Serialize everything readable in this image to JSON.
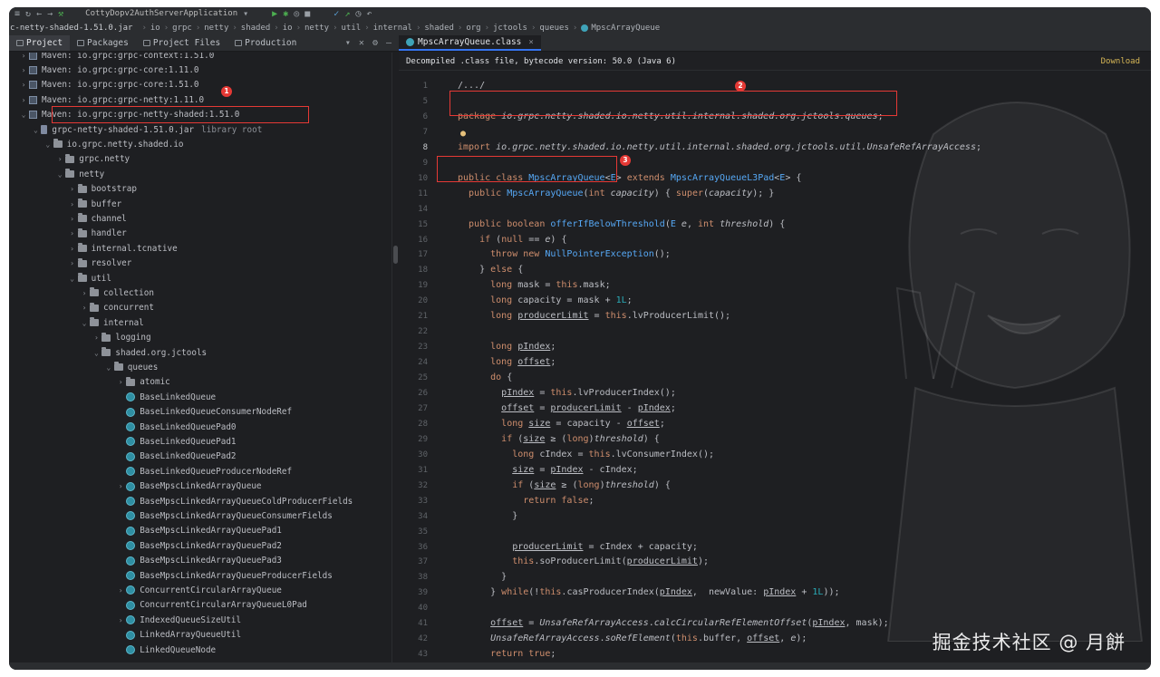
{
  "window": {
    "run_config": "CottyDopv2AuthServerApplication"
  },
  "breadcrumb": {
    "jar": "c-netty-shaded-1.51.0.jar",
    "parts": [
      "io",
      "grpc",
      "netty",
      "shaded",
      "io",
      "netty",
      "util",
      "internal",
      "shaded",
      "org",
      "jctools",
      "queues"
    ],
    "current": "MpscArrayQueue"
  },
  "project_tabs": [
    {
      "label": "Project",
      "active": true
    },
    {
      "label": "Packages",
      "active": false
    },
    {
      "label": "Project Files",
      "active": false
    },
    {
      "label": "Production",
      "active": false
    }
  ],
  "editor_tab": {
    "label": "MpscArrayQueue.class"
  },
  "banner": {
    "text": "Decompiled .class file, bytecode version: 50.0 (Java 6)",
    "action": "Download"
  },
  "tree": [
    {
      "indent": 0,
      "arrow": "right",
      "icon": "lib",
      "label": "Maven: io.grpc:grpc-context:1.51.0"
    },
    {
      "indent": 0,
      "arrow": "right",
      "icon": "lib",
      "label": "Maven: io.grpc:grpc-core:1.11.0"
    },
    {
      "indent": 0,
      "arrow": "right",
      "icon": "lib",
      "label": "Maven: io.grpc:grpc-core:1.51.0"
    },
    {
      "indent": 0,
      "arrow": "right",
      "icon": "lib",
      "label": "Maven: io.grpc:grpc-netty:1.11.0"
    },
    {
      "indent": 0,
      "arrow": "down",
      "icon": "lib",
      "label": "Maven: io.grpc:grpc-netty-shaded:1.51.0"
    },
    {
      "indent": 1,
      "arrow": "down",
      "icon": "jar",
      "label": "grpc-netty-shaded-1.51.0.jar",
      "note": "library root"
    },
    {
      "indent": 2,
      "arrow": "down",
      "icon": "folder",
      "label": "io.grpc.netty.shaded.io"
    },
    {
      "indent": 3,
      "arrow": "right",
      "icon": "folder",
      "label": "grpc.netty"
    },
    {
      "indent": 3,
      "arrow": "down",
      "icon": "folder",
      "label": "netty"
    },
    {
      "indent": 4,
      "arrow": "right",
      "icon": "folder",
      "label": "bootstrap"
    },
    {
      "indent": 4,
      "arrow": "right",
      "icon": "folder",
      "label": "buffer"
    },
    {
      "indent": 4,
      "arrow": "right",
      "icon": "folder",
      "label": "channel"
    },
    {
      "indent": 4,
      "arrow": "right",
      "icon": "folder",
      "label": "handler"
    },
    {
      "indent": 4,
      "arrow": "right",
      "icon": "folder",
      "label": "internal.tcnative"
    },
    {
      "indent": 4,
      "arrow": "right",
      "icon": "folder",
      "label": "resolver"
    },
    {
      "indent": 4,
      "arrow": "down",
      "icon": "folder",
      "label": "util"
    },
    {
      "indent": 5,
      "arrow": "right",
      "icon": "folder",
      "label": "collection"
    },
    {
      "indent": 5,
      "arrow": "right",
      "icon": "folder",
      "label": "concurrent"
    },
    {
      "indent": 5,
      "arrow": "down",
      "icon": "folder",
      "label": "internal"
    },
    {
      "indent": 6,
      "arrow": "right",
      "icon": "folder",
      "label": "logging"
    },
    {
      "indent": 6,
      "arrow": "down",
      "icon": "folder",
      "label": "shaded.org.jctools"
    },
    {
      "indent": 7,
      "arrow": "down",
      "icon": "folder",
      "label": "queues"
    },
    {
      "indent": 8,
      "arrow": "right",
      "icon": "folder",
      "label": "atomic"
    },
    {
      "indent": 8,
      "arrow": "none",
      "icon": "cls",
      "label": "BaseLinkedQueue"
    },
    {
      "indent": 8,
      "arrow": "none",
      "icon": "cls",
      "label": "BaseLinkedQueueConsumerNodeRef"
    },
    {
      "indent": 8,
      "arrow": "none",
      "icon": "cls",
      "label": "BaseLinkedQueuePad0"
    },
    {
      "indent": 8,
      "arrow": "none",
      "icon": "cls",
      "label": "BaseLinkedQueuePad1"
    },
    {
      "indent": 8,
      "arrow": "none",
      "icon": "cls",
      "label": "BaseLinkedQueuePad2"
    },
    {
      "indent": 8,
      "arrow": "none",
      "icon": "cls",
      "label": "BaseLinkedQueueProducerNodeRef"
    },
    {
      "indent": 8,
      "arrow": "right",
      "icon": "cls",
      "label": "BaseMpscLinkedArrayQueue"
    },
    {
      "indent": 8,
      "arrow": "none",
      "icon": "cls",
      "label": "BaseMpscLinkedArrayQueueColdProducerFields"
    },
    {
      "indent": 8,
      "arrow": "none",
      "icon": "cls",
      "label": "BaseMpscLinkedArrayQueueConsumerFields"
    },
    {
      "indent": 8,
      "arrow": "none",
      "icon": "cls",
      "label": "BaseMpscLinkedArrayQueuePad1"
    },
    {
      "indent": 8,
      "arrow": "none",
      "icon": "cls",
      "label": "BaseMpscLinkedArrayQueuePad2"
    },
    {
      "indent": 8,
      "arrow": "none",
      "icon": "cls",
      "label": "BaseMpscLinkedArrayQueuePad3"
    },
    {
      "indent": 8,
      "arrow": "none",
      "icon": "cls",
      "label": "BaseMpscLinkedArrayQueueProducerFields"
    },
    {
      "indent": 8,
      "arrow": "right",
      "icon": "cls",
      "label": "ConcurrentCircularArrayQueue"
    },
    {
      "indent": 8,
      "arrow": "none",
      "icon": "cls",
      "label": "ConcurrentCircularArrayQueueL0Pad"
    },
    {
      "indent": 8,
      "arrow": "right",
      "icon": "cls",
      "label": "IndexedQueueSizeUtil"
    },
    {
      "indent": 8,
      "arrow": "none",
      "icon": "cls",
      "label": "LinkedArrayQueueUtil"
    },
    {
      "indent": 8,
      "arrow": "none",
      "icon": "cls",
      "label": "LinkedQueueNode"
    }
  ],
  "code": [
    {
      "n": "1",
      "html": "<span class='pk'>/.../</span>"
    },
    {
      "n": "5",
      "html": ""
    },
    {
      "n": "6",
      "html": "<span class='kw'>package</span> <span class='it'>io.grpc.netty.shaded.io.netty.util.internal.shaded.org.jctools.queues</span>;"
    },
    {
      "n": "7",
      "html": ""
    },
    {
      "n": "8",
      "html": "<span class='kw'>import</span> <span class='it'>io.grpc.netty.shaded.io.netty.util.internal.shaded.org.jctools.util.UnsafeRefArrayAccess</span>;"
    },
    {
      "n": "9",
      "html": ""
    },
    {
      "n": "10",
      "html": "<span class='kw'>public class</span> <span class='ty'>MpscArrayQueue</span>&lt;<span class='ty'>E</span>&gt; <span class='kw'>extends</span> <span class='ty'>MpscArrayQueueL3Pad</span>&lt;<span class='ty'>E</span>&gt; {"
    },
    {
      "n": "11",
      "html": "  <span class='kw'>public</span> <span class='fn'>MpscArrayQueue</span>(<span class='kw'>int</span> <span class='st'>capacity</span>) { <span class='kw'>super</span>(<span class='st'>capacity</span>); }"
    },
    {
      "n": "14",
      "html": ""
    },
    {
      "n": "15",
      "html": "  <span class='kw'>public boolean</span> <span class='fn'>offerIfBelowThreshold</span>(<span class='ty'>E</span> <span class='st'>e</span>, <span class='kw'>int</span> <span class='st'>threshold</span>) {"
    },
    {
      "n": "16",
      "html": "    <span class='kw'>if</span> (<span class='kw'>null</span> == <span class='st'>e</span>) {"
    },
    {
      "n": "17",
      "html": "      <span class='kw'>throw new</span> <span class='ty'>NullPointerException</span>();"
    },
    {
      "n": "18",
      "html": "    } <span class='kw'>else</span> {"
    },
    {
      "n": "19",
      "html": "      <span class='kw'>long</span> mask = <span class='kw'>this</span>.mask;"
    },
    {
      "n": "20",
      "html": "      <span class='kw'>long</span> capacity = mask + <span class='num'>1L</span>;"
    },
    {
      "n": "21",
      "html": "      <span class='kw'>long</span> <span class='u'>producerLimit</span> = <span class='kw'>this</span>.lvProducerLimit();"
    },
    {
      "n": "22",
      "html": ""
    },
    {
      "n": "23",
      "html": "      <span class='kw'>long</span> <span class='u'>pIndex</span>;"
    },
    {
      "n": "24",
      "html": "      <span class='kw'>long</span> <span class='u'>offset</span>;"
    },
    {
      "n": "25",
      "html": "      <span class='kw'>do</span> {"
    },
    {
      "n": "26",
      "html": "        <span class='u'>pIndex</span> = <span class='kw'>this</span>.lvProducerIndex();"
    },
    {
      "n": "27",
      "html": "        <span class='u'>offset</span> = <span class='u'>producerLimit</span> - <span class='u'>pIndex</span>;"
    },
    {
      "n": "28",
      "html": "        <span class='kw'>long</span> <span class='u'>size</span> = capacity - <span class='u'>offset</span>;"
    },
    {
      "n": "29",
      "html": "        <span class='kw'>if</span> (<span class='u'>size</span> ≥ (<span class='kw'>long</span>)<span class='st'>threshold</span>) {"
    },
    {
      "n": "30",
      "html": "          <span class='kw'>long</span> cIndex = <span class='kw'>this</span>.lvConsumerIndex();"
    },
    {
      "n": "31",
      "html": "          <span class='u'>size</span> = <span class='u'>pIndex</span> - cIndex;"
    },
    {
      "n": "32",
      "html": "          <span class='kw'>if</span> (<span class='u'>size</span> ≥ (<span class='kw'>long</span>)<span class='st'>threshold</span>) {"
    },
    {
      "n": "33",
      "html": "            <span class='kw'>return false</span>;"
    },
    {
      "n": "34",
      "html": "          }"
    },
    {
      "n": "35",
      "html": ""
    },
    {
      "n": "36",
      "html": "          <span class='u'>producerLimit</span> = cIndex + capacity;"
    },
    {
      "n": "37",
      "html": "          <span class='kw'>this</span>.soProducerLimit(<span class='u'>producerLimit</span>);"
    },
    {
      "n": "38",
      "html": "        }"
    },
    {
      "n": "39",
      "html": "      } <span class='kw'>while</span>(!<span class='kw'>this</span>.casProducerIndex(<span class='u'>pIndex</span>,  newValue: <span class='u'>pIndex</span> + <span class='num'>1L</span>));"
    },
    {
      "n": "40",
      "html": ""
    },
    {
      "n": "41",
      "html": "      <span class='u'>offset</span> = <span class='it'>UnsafeRefArrayAccess</span>.<span class='it'>calcCircularRefElementOffset</span>(<span class='u'>pIndex</span>, mask);"
    },
    {
      "n": "42",
      "html": "      <span class='it'>UnsafeRefArrayAccess</span>.<span class='it'>soRefElement</span>(<span class='kw'>this</span>.buffer, <span class='u'>offset</span>, <span class='st'>e</span>);"
    },
    {
      "n": "43",
      "html": "      <span class='kw'>return true</span>;"
    }
  ],
  "annotations": [
    "1",
    "2",
    "3"
  ],
  "watermark": "掘金技术社区 @ 月餅"
}
